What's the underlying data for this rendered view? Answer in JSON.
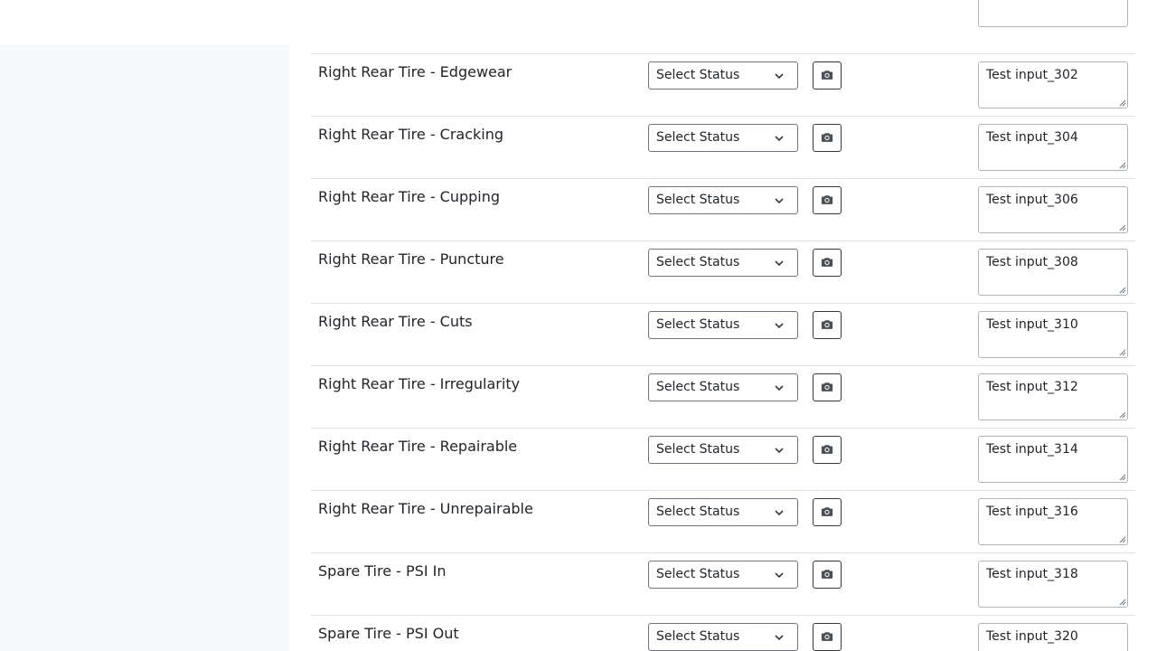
{
  "select_placeholder": "Select Status",
  "rows": [
    {
      "label": "Right Rear Tire - Edgewear",
      "status": "Select Status",
      "note": "Test input_302"
    },
    {
      "label": "Right Rear Tire - Cracking",
      "status": "Select Status",
      "note": "Test input_304"
    },
    {
      "label": "Right Rear Tire - Cupping",
      "status": "Select Status",
      "note": "Test input_306"
    },
    {
      "label": "Right Rear Tire - Puncture",
      "status": "Select Status",
      "note": "Test input_308"
    },
    {
      "label": "Right Rear Tire - Cuts",
      "status": "Select Status",
      "note": "Test input_310"
    },
    {
      "label": "Right Rear Tire - Irregularity",
      "status": "Select Status",
      "note": "Test input_312"
    },
    {
      "label": "Right Rear Tire - Repairable",
      "status": "Select Status",
      "note": "Test input_314"
    },
    {
      "label": "Right Rear Tire - Unrepairable",
      "status": "Select Status",
      "note": "Test input_316"
    },
    {
      "label": "Spare Tire - PSI In",
      "status": "Select Status",
      "note": "Test input_318"
    },
    {
      "label": "Spare Tire - PSI Out",
      "status": "Select Status",
      "note": "Test input_320"
    }
  ],
  "icons": {
    "camera": "camera-icon",
    "dropdown": "chevron-down-icon",
    "resize": "resize-grip-icon"
  }
}
